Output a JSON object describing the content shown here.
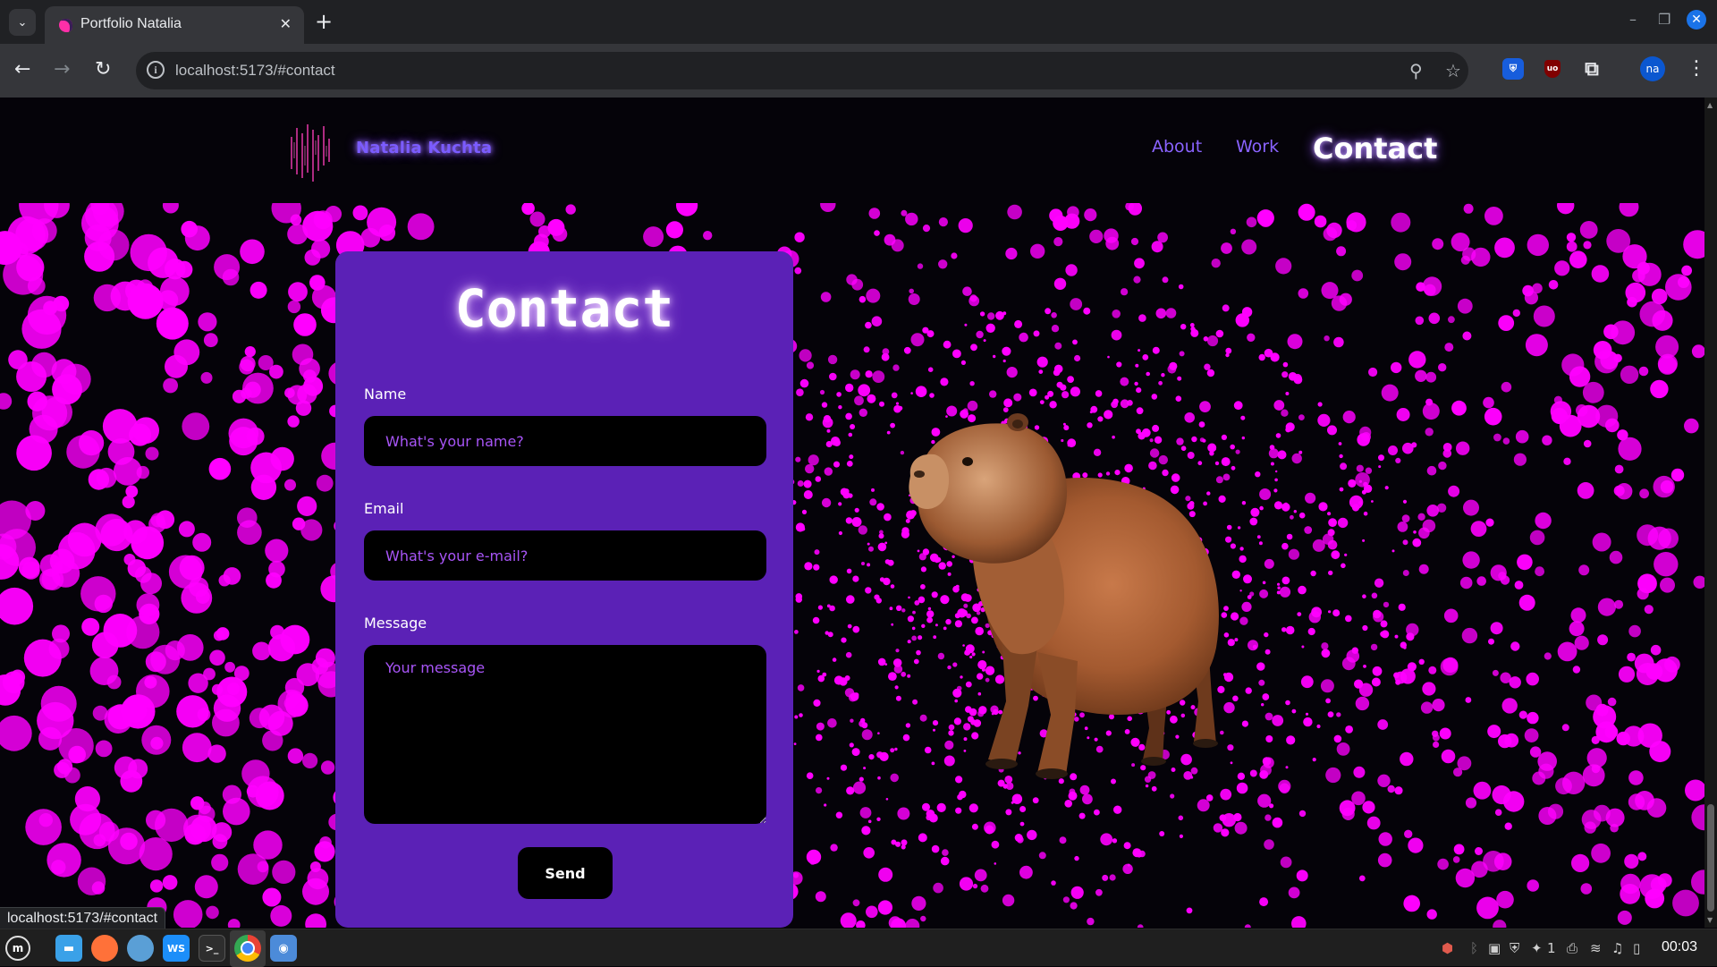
{
  "browser": {
    "tab_title": "Portfolio Natalia",
    "tab_close_icon": "close-icon",
    "new_tab_icon": "plus-icon",
    "url": "localhost:5173/#contact",
    "profile_initials": "na",
    "status_url": "localhost:5173/#contact"
  },
  "site": {
    "logo_text": "Natalia Kuchta",
    "nav": [
      {
        "label": "About",
        "active": false
      },
      {
        "label": "Work",
        "active": false
      },
      {
        "label": "Contact",
        "active": true
      }
    ],
    "accent_color": "#8a63ff",
    "particle_color": "#ff00ff"
  },
  "contact": {
    "title": "Contact",
    "name_label": "Name",
    "name_placeholder": "What's your name?",
    "email_label": "Email",
    "email_placeholder": "What's your e-mail?",
    "message_label": "Message",
    "message_placeholder": "Your message",
    "send_label": "Send",
    "card_color": "#5b21b6"
  },
  "taskbar": {
    "time": "00:03",
    "notification_count": "1",
    "apps": [
      "menu-icon",
      "files-icon",
      "firefox-icon",
      "browser-icon",
      "webstorm-icon",
      "terminal-icon",
      "chrome-icon",
      "camera-icon"
    ]
  }
}
